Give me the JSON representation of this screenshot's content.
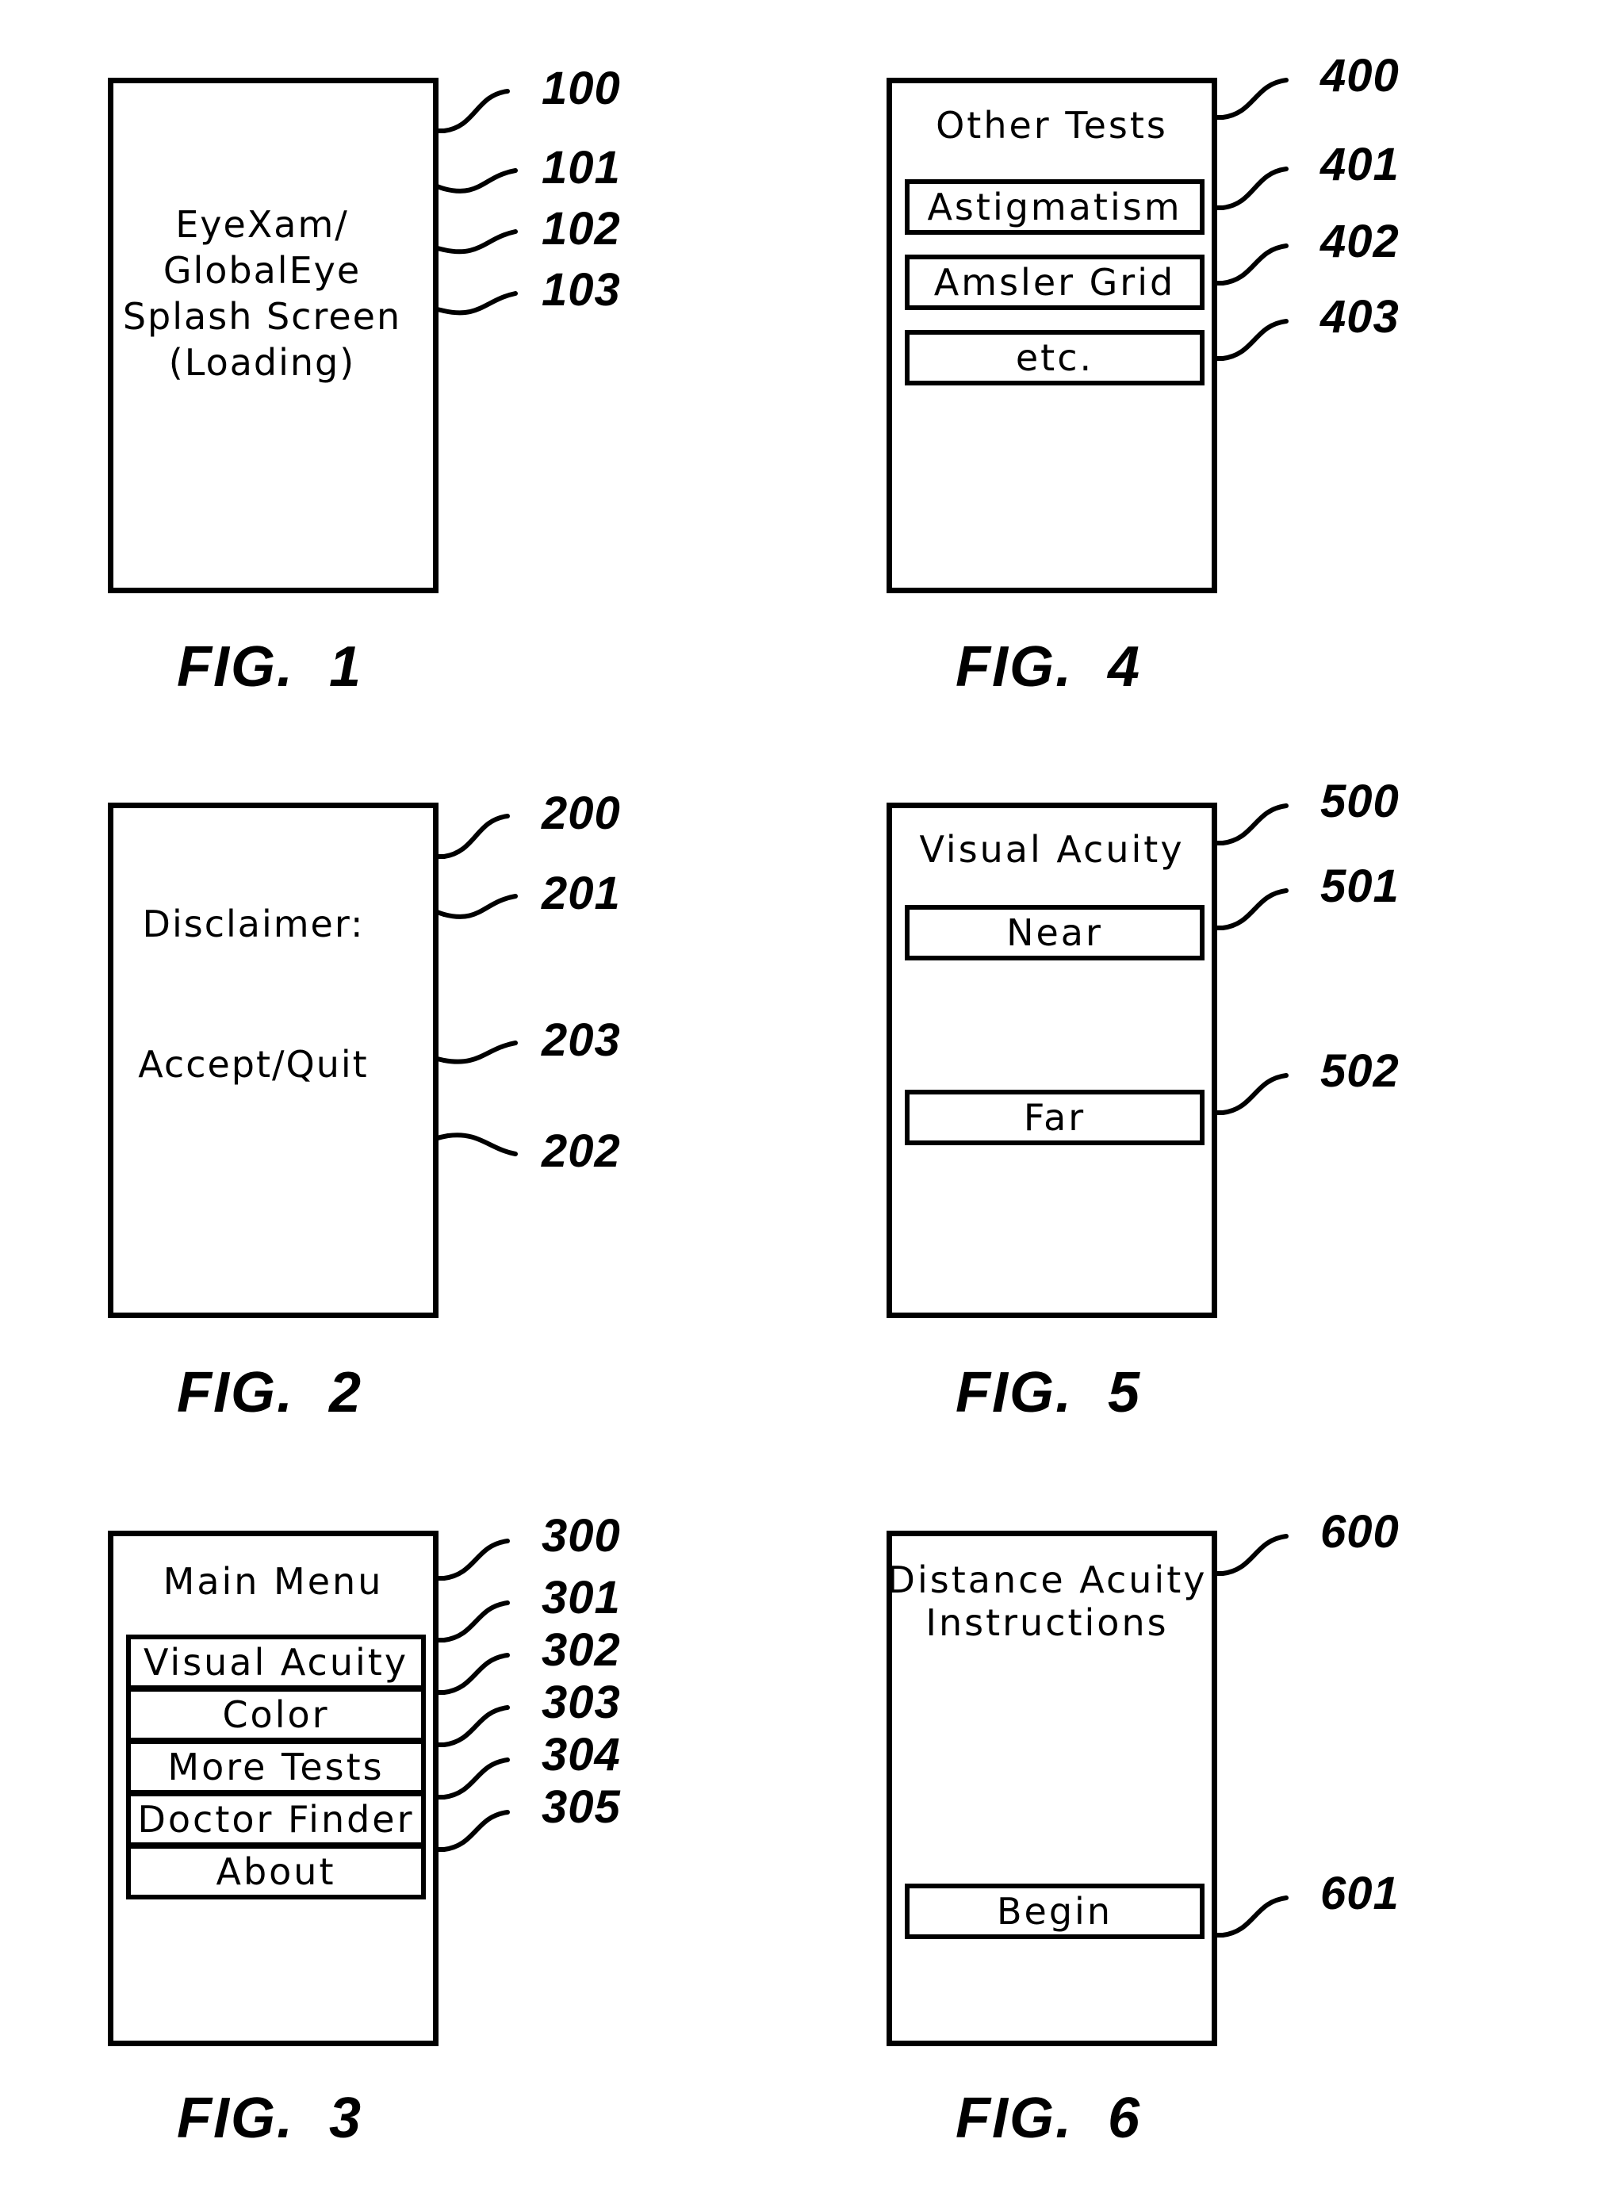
{
  "document": {
    "type": "patent-drawing-sheet",
    "figures": [
      {
        "id": "fig1",
        "caption": "FIG.  1",
        "screen_text": "EyeXam/\nGlobalEye\nSplash  Screen\n(Loading)",
        "buttons": [],
        "refs": [
          {
            "label": "100"
          },
          {
            "label": "101"
          },
          {
            "label": "102"
          },
          {
            "label": "103"
          }
        ]
      },
      {
        "id": "fig2",
        "caption": "FIG.  2",
        "title": "Disclaimer:",
        "secondary_text": "Accept/Quit",
        "buttons": [],
        "refs": [
          {
            "label": "200"
          },
          {
            "label": "201"
          },
          {
            "label": "203"
          },
          {
            "label": "202"
          }
        ]
      },
      {
        "id": "fig3",
        "caption": "FIG.  3",
        "title": "Main Menu",
        "buttons": [
          {
            "label": "Visual Acuity"
          },
          {
            "label": "Color"
          },
          {
            "label": "More Tests"
          },
          {
            "label": "Doctor Finder"
          },
          {
            "label": "About"
          }
        ],
        "refs": [
          {
            "label": "300"
          },
          {
            "label": "301"
          },
          {
            "label": "302"
          },
          {
            "label": "303"
          },
          {
            "label": "304"
          },
          {
            "label": "305"
          }
        ]
      },
      {
        "id": "fig4",
        "caption": "FIG.  4",
        "title": "Other  Tests",
        "buttons": [
          {
            "label": "Astigmatism"
          },
          {
            "label": "Amsler  Grid"
          },
          {
            "label": "etc."
          }
        ],
        "refs": [
          {
            "label": "400"
          },
          {
            "label": "401"
          },
          {
            "label": "402"
          },
          {
            "label": "403"
          }
        ]
      },
      {
        "id": "fig5",
        "caption": "FIG.  5",
        "title": "Visual  Acuity",
        "buttons": [
          {
            "label": "Near"
          },
          {
            "label": "Far"
          }
        ],
        "refs": [
          {
            "label": "500"
          },
          {
            "label": "501"
          },
          {
            "label": "502"
          }
        ]
      },
      {
        "id": "fig6",
        "caption": "FIG.  6",
        "title": "Distance  Acuity\nInstructions",
        "buttons": [
          {
            "label": "Begin"
          }
        ],
        "refs": [
          {
            "label": "600"
          },
          {
            "label": "601"
          }
        ]
      }
    ]
  },
  "colors": {
    "ink": "#000000",
    "paper": "#ffffff"
  }
}
